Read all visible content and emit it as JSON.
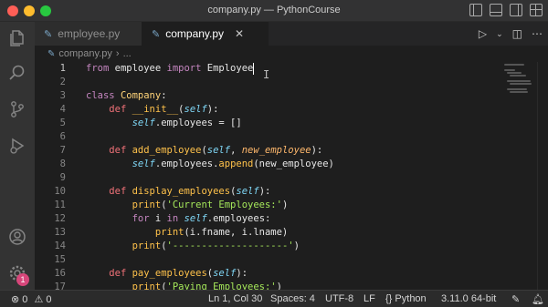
{
  "window": {
    "title": "company.py — PythonCourse"
  },
  "tabs": [
    {
      "label": "employee.py",
      "icon": "python-file-icon",
      "active": false
    },
    {
      "label": "company.py",
      "icon": "python-file-icon",
      "active": true,
      "close": "✕"
    }
  ],
  "breadcrumb": {
    "file": "company.py",
    "separator": "›",
    "more": "..."
  },
  "editor": {
    "lines": [
      {
        "n": "1",
        "tokens": [
          [
            "kw",
            "from"
          ],
          [
            "plain",
            " employee "
          ],
          [
            "kw",
            "import"
          ],
          [
            "plain",
            " Employee"
          ]
        ]
      },
      {
        "n": "2",
        "tokens": []
      },
      {
        "n": "3",
        "tokens": [
          [
            "kw",
            "class"
          ],
          [
            "plain",
            " "
          ],
          [
            "cls",
            "Company"
          ],
          [
            "plain",
            ":"
          ]
        ]
      },
      {
        "n": "4",
        "tokens": [
          [
            "plain",
            "    "
          ],
          [
            "def",
            "def"
          ],
          [
            "plain",
            " "
          ],
          [
            "fn",
            "__init__"
          ],
          [
            "plain",
            "("
          ],
          [
            "self",
            "self"
          ],
          [
            "plain",
            "):"
          ]
        ]
      },
      {
        "n": "5",
        "tokens": [
          [
            "plain",
            "        "
          ],
          [
            "self",
            "self"
          ],
          [
            "plain",
            ".employees = []"
          ]
        ]
      },
      {
        "n": "6",
        "tokens": []
      },
      {
        "n": "7",
        "tokens": [
          [
            "plain",
            "    "
          ],
          [
            "def",
            "def"
          ],
          [
            "plain",
            " "
          ],
          [
            "fn",
            "add_employee"
          ],
          [
            "plain",
            "("
          ],
          [
            "self",
            "self"
          ],
          [
            "plain",
            ", "
          ],
          [
            "param",
            "new_employee"
          ],
          [
            "plain",
            "):"
          ]
        ]
      },
      {
        "n": "8",
        "tokens": [
          [
            "plain",
            "        "
          ],
          [
            "self",
            "self"
          ],
          [
            "plain",
            ".employees."
          ],
          [
            "fn",
            "append"
          ],
          [
            "plain",
            "(new_employee)"
          ]
        ]
      },
      {
        "n": "9",
        "tokens": []
      },
      {
        "n": "10",
        "tokens": [
          [
            "plain",
            "    "
          ],
          [
            "def",
            "def"
          ],
          [
            "plain",
            " "
          ],
          [
            "fn",
            "display_employees"
          ],
          [
            "plain",
            "("
          ],
          [
            "self",
            "self"
          ],
          [
            "plain",
            "):"
          ]
        ]
      },
      {
        "n": "11",
        "tokens": [
          [
            "plain",
            "        "
          ],
          [
            "fn",
            "print"
          ],
          [
            "plain",
            "("
          ],
          [
            "str",
            "'Current Employees:'"
          ],
          [
            "plain",
            ")"
          ]
        ]
      },
      {
        "n": "12",
        "tokens": [
          [
            "plain",
            "        "
          ],
          [
            "kw",
            "for"
          ],
          [
            "plain",
            " i "
          ],
          [
            "kw",
            "in"
          ],
          [
            "plain",
            " "
          ],
          [
            "self",
            "self"
          ],
          [
            "plain",
            ".employees:"
          ]
        ]
      },
      {
        "n": "13",
        "tokens": [
          [
            "plain",
            "            "
          ],
          [
            "fn",
            "print"
          ],
          [
            "plain",
            "(i.fname, i.lname)"
          ]
        ]
      },
      {
        "n": "14",
        "tokens": [
          [
            "plain",
            "        "
          ],
          [
            "fn",
            "print"
          ],
          [
            "plain",
            "("
          ],
          [
            "str",
            "'--------------------'"
          ],
          [
            "plain",
            ")"
          ]
        ]
      },
      {
        "n": "15",
        "tokens": []
      },
      {
        "n": "16",
        "tokens": [
          [
            "plain",
            "    "
          ],
          [
            "def",
            "def"
          ],
          [
            "plain",
            " "
          ],
          [
            "fn",
            "pay_employees"
          ],
          [
            "plain",
            "("
          ],
          [
            "self",
            "self"
          ],
          [
            "plain",
            "):"
          ]
        ]
      },
      {
        "n": "17",
        "tokens": [
          [
            "plain",
            "        "
          ],
          [
            "fn",
            "print"
          ],
          [
            "plain",
            "("
          ],
          [
            "str",
            "'Paying Employees:'"
          ],
          [
            "plain",
            ")"
          ]
        ]
      }
    ]
  },
  "activity_bar": {
    "icons": [
      "explorer-icon",
      "search-icon",
      "source-control-icon",
      "run-debug-icon",
      "account-icon",
      "settings-icon"
    ],
    "badge": "1"
  },
  "statusbar": {
    "errors": "0",
    "warnings": "0",
    "cursor": "Ln 1, Col 30",
    "spaces": "Spaces: 4",
    "encoding": "UTF-8",
    "eol": "LF",
    "language": "Python",
    "interpreter": "3.11.0 64-bit"
  },
  "colors": {
    "keyword": "#c586c0",
    "def": "#f07178",
    "function": "#ffc24b",
    "self": "#7fd6f5",
    "string": "#a5e75a"
  }
}
